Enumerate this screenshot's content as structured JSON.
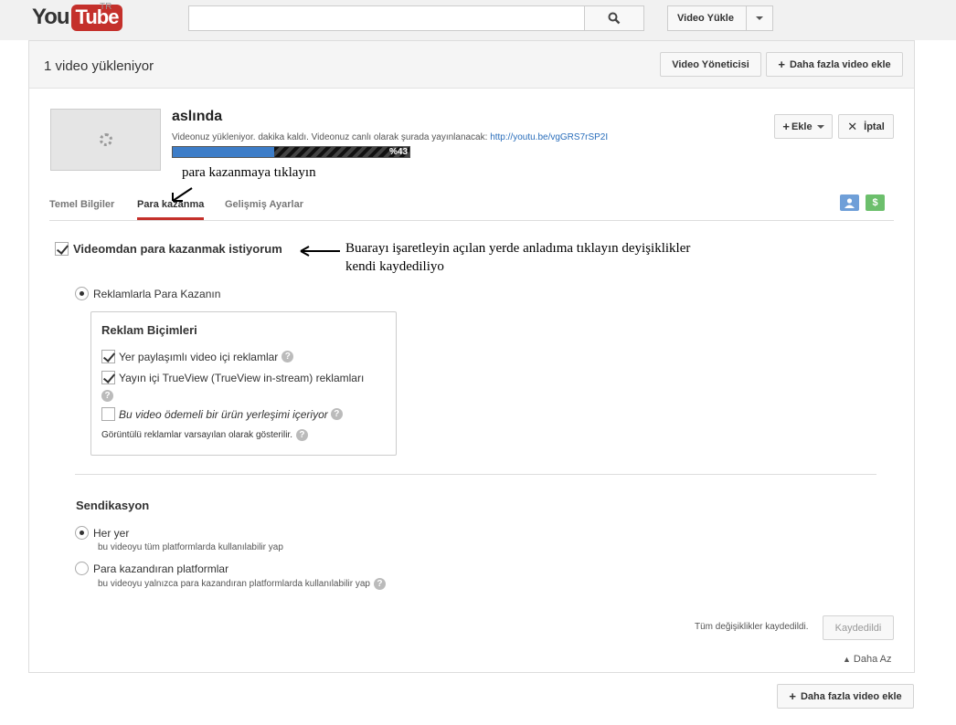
{
  "topbar": {
    "logo_you": "You",
    "logo_tube": "Tube",
    "logo_region": "TR",
    "search_placeholder": "",
    "upload_label": "Video Yükle"
  },
  "header": {
    "title": "1 video yükleniyor",
    "manager_label": "Video Yöneticisi",
    "add_more_label": "Daha fazla video ekle"
  },
  "video": {
    "title": "aslında",
    "status_text": "Videonuz yükleniyor. dakika kaldı. Videonuz canlı olarak şurada yayınlanacak:",
    "url": "http://youtu.be/vgGRS7rSP2I",
    "progress_label": "%43",
    "progress_percent": 43,
    "add_label": "Ekle",
    "cancel_label": "İptal"
  },
  "annotations": {
    "tab_hint": "para kazanmaya tıklayın",
    "checkbox_hint_line1": "Buarayı işaretleyin açılan yerde anladıma tıklayın deyişiklikler",
    "checkbox_hint_line2": "kendi kaydediliyo"
  },
  "tabs": [
    {
      "label": "Temel Bilgiler",
      "active": false
    },
    {
      "label": "Para kazanma",
      "active": true
    },
    {
      "label": "Gelişmiş Ayarlar",
      "active": false
    }
  ],
  "tab_icons": [
    {
      "icon": "users-icon",
      "color": "#6f9fd8"
    },
    {
      "icon": "dollar-icon",
      "glyph": "$",
      "color": "#6cbf6c"
    }
  ],
  "monetize": {
    "checkbox_label": "Videomdan para kazanmak istiyorum",
    "checked": true,
    "ads_radio_label": "Reklamlarla Para Kazanın",
    "ad_formats_title": "Reklam Biçimleri",
    "format_overlay": "Yer paylaşımlı video içi reklamlar",
    "format_trueview": "Yayın içi TrueView (TrueView in-stream) reklamları",
    "format_paid_placement": "Bu video ödemeli bir ürün yerleşimi içeriyor",
    "display_ads_note": "Görüntülü reklamlar varsayılan olarak gösterilir."
  },
  "syndication": {
    "title": "Sendikasyon",
    "everywhere_label": "Her yer",
    "everywhere_desc": "bu videoyu tüm platformlarda kullanılabilir yap",
    "monetized_label": "Para kazandıran platformlar",
    "monetized_desc": "bu videoyu yalnızca para kazandıran platformlarda kullanılabilir yap"
  },
  "footer": {
    "saved_text": "Tüm değişiklikler kaydedildi.",
    "saved_button": "Kaydedildi",
    "less_label": "Daha Az",
    "add_more_label": "Daha fazla video ekle"
  }
}
